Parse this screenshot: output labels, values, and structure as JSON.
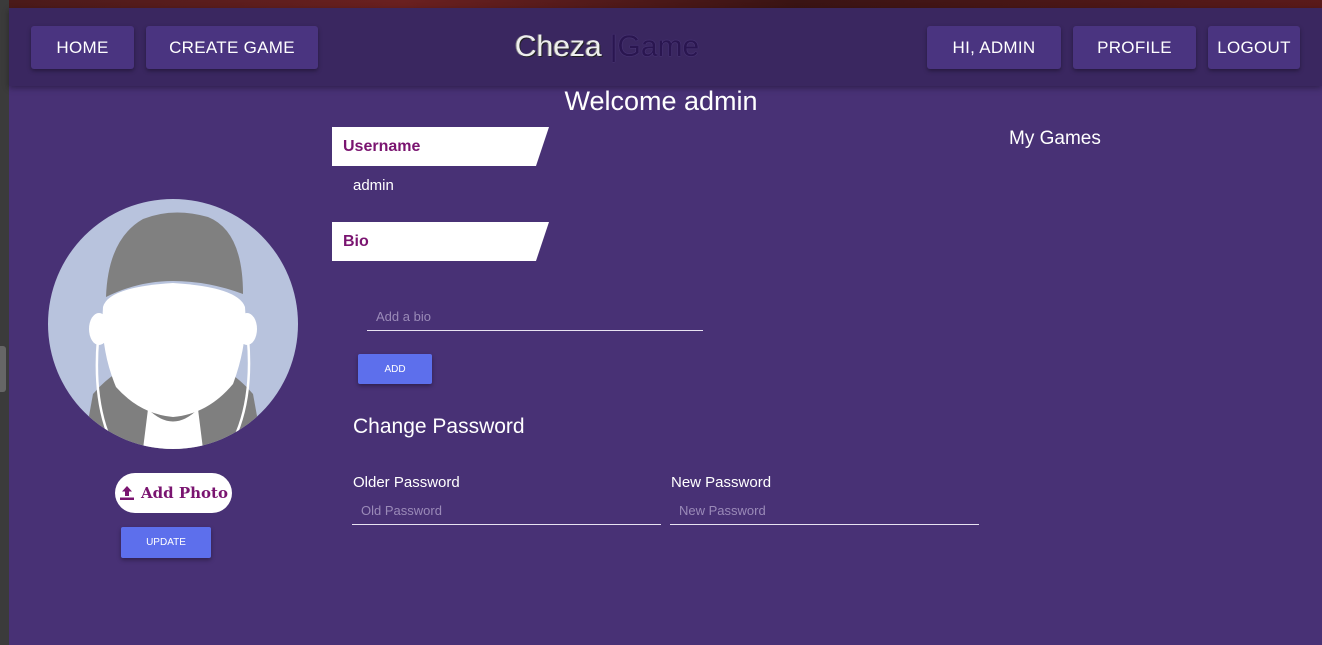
{
  "nav": {
    "home": "HOME",
    "create_game": "CREATE GAME",
    "brand_part1": "Cheza",
    "brand_part2": "|Game",
    "greeting": "HI, ADMIN",
    "profile": "PROFILE",
    "logout": "LOGOUT"
  },
  "welcome": "Welcome admin",
  "profile": {
    "add_photo_label": "Add Photo",
    "update_label": "UPDATE",
    "username_heading": "Username",
    "username_value": "admin",
    "bio_heading": "Bio",
    "bio_placeholder": "Add a bio",
    "add_label": "ADD"
  },
  "password": {
    "title": "Change Password",
    "older_label": "Older Password",
    "older_placeholder": "Old Password",
    "new_label": "New Password",
    "new_placeholder": "New Password"
  },
  "my_games": {
    "title": "My Games"
  },
  "colors": {
    "background": "#483175",
    "navbar": "#3a2760",
    "accent_button": "#5d6fec",
    "heading_text": "#7a1470"
  },
  "icons": [
    "upload-icon",
    "avatar-placeholder"
  ]
}
